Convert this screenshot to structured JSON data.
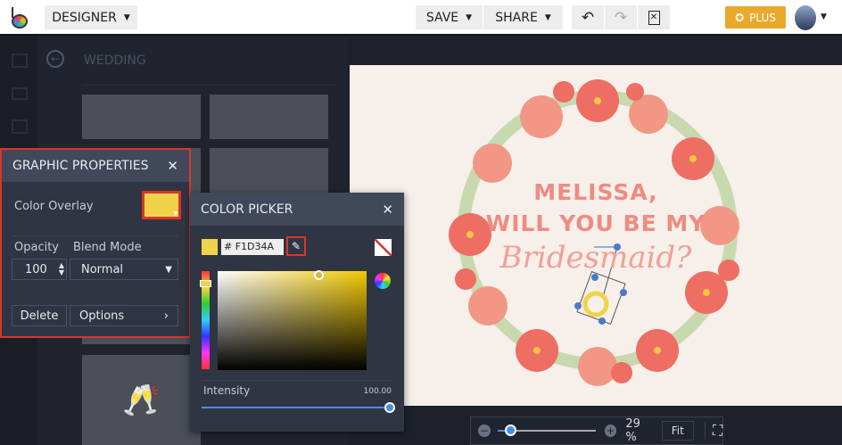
{
  "topbar": {
    "mode": "DESIGNER",
    "save": "SAVE",
    "share": "SHARE",
    "plus": "PLUS"
  },
  "library": {
    "title": "WEDDING"
  },
  "graphic_properties": {
    "title": "GRAPHIC PROPERTIES",
    "color_overlay": "Color Overlay",
    "opacity_label": "Opacity",
    "blend_label": "Blend Mode",
    "opacity": "100",
    "blend": "Normal",
    "delete": "Delete",
    "options": "Options",
    "overlay_color": "#F1D34A"
  },
  "color_picker": {
    "title": "COLOR PICKER",
    "hex": "# F1D34A",
    "intensity_label": "Intensity",
    "intensity": "100.00"
  },
  "canvas": {
    "line1": "MELISSA,",
    "line2": "WILL YOU BE MY",
    "line3": "Bridesmaid?"
  },
  "zoom": {
    "value": "29 %",
    "fit": "Fit"
  }
}
